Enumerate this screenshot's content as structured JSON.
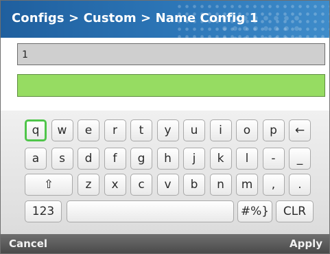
{
  "header": {
    "title": "Configs > Custom > Name Config 1"
  },
  "fields": {
    "top_value": "1",
    "bottom_value": ""
  },
  "keyboard": {
    "row1": [
      "q",
      "w",
      "e",
      "r",
      "t",
      "y",
      "u",
      "i",
      "o",
      "p",
      "←"
    ],
    "row2": [
      "a",
      "s",
      "d",
      "f",
      "g",
      "h",
      "j",
      "k",
      "l",
      "-",
      "_"
    ],
    "row3": [
      "⇧",
      "z",
      "x",
      "c",
      "v",
      "b",
      "n",
      "m",
      ",",
      "."
    ],
    "row4": [
      "123",
      "",
      "#%}",
      "CLR"
    ],
    "selected_key": "q"
  },
  "footer": {
    "cancel_label": "Cancel",
    "apply_label": "Apply"
  },
  "colors": {
    "header_blue": "#2d77b8",
    "input_highlight_green": "#96dc62",
    "selected_key_border": "#4fc54a",
    "footer_gray": "#555555"
  }
}
